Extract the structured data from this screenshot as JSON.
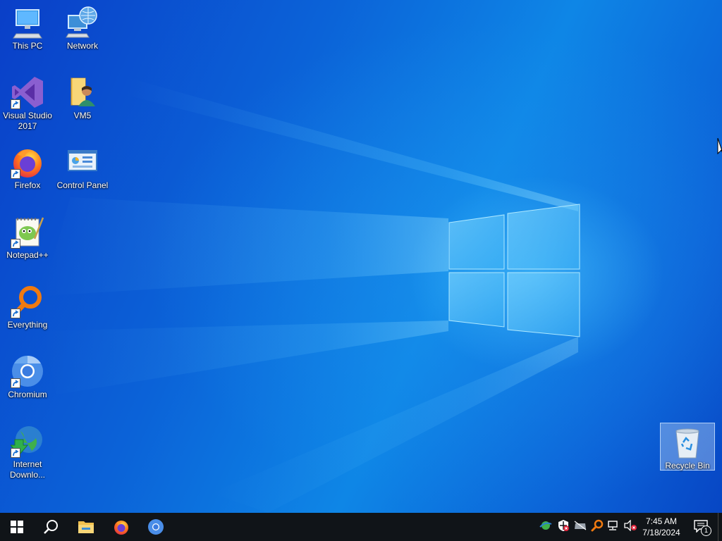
{
  "desktop": {
    "icons": [
      {
        "name": "this-pc",
        "label": "This PC",
        "icon": "computer-icon"
      },
      {
        "name": "network",
        "label": "Network",
        "icon": "network-icon"
      },
      {
        "name": "visual-studio",
        "label": "Visual Studio 2017",
        "icon": "visual-studio-icon"
      },
      {
        "name": "vm5",
        "label": "VM5",
        "icon": "user-folder-icon"
      },
      {
        "name": "firefox",
        "label": "Firefox",
        "icon": "firefox-icon"
      },
      {
        "name": "control-panel",
        "label": "Control Panel",
        "icon": "control-panel-icon"
      },
      {
        "name": "notepadpp",
        "label": "Notepad++",
        "icon": "notepadpp-icon"
      },
      {
        "name": "everything",
        "label": "Everything",
        "icon": "search-magnifier-icon"
      },
      {
        "name": "chromium",
        "label": "Chromium",
        "icon": "chromium-icon"
      },
      {
        "name": "internet-download",
        "label": "Internet Downlo...",
        "icon": "idm-icon"
      },
      {
        "name": "recycle-bin",
        "label": "Recycle Bin",
        "icon": "recycle-bin-icon"
      }
    ]
  },
  "taskbar": {
    "start": "windows-start-icon",
    "search": "search-icon",
    "pinned": [
      "file-explorer-icon",
      "firefox-icon",
      "chromium-icon"
    ],
    "tray": [
      "network-globe-icon",
      "defender-icon",
      "drive-icon",
      "everything-icon",
      "network-wired-icon",
      "volume-muted-icon"
    ],
    "clock": {
      "time": "7:45 AM",
      "date": "7/18/2024"
    },
    "notifications": {
      "count": "1"
    }
  },
  "colors": {
    "desktop_blue": "#0b63d8",
    "taskbar": "#101418"
  }
}
